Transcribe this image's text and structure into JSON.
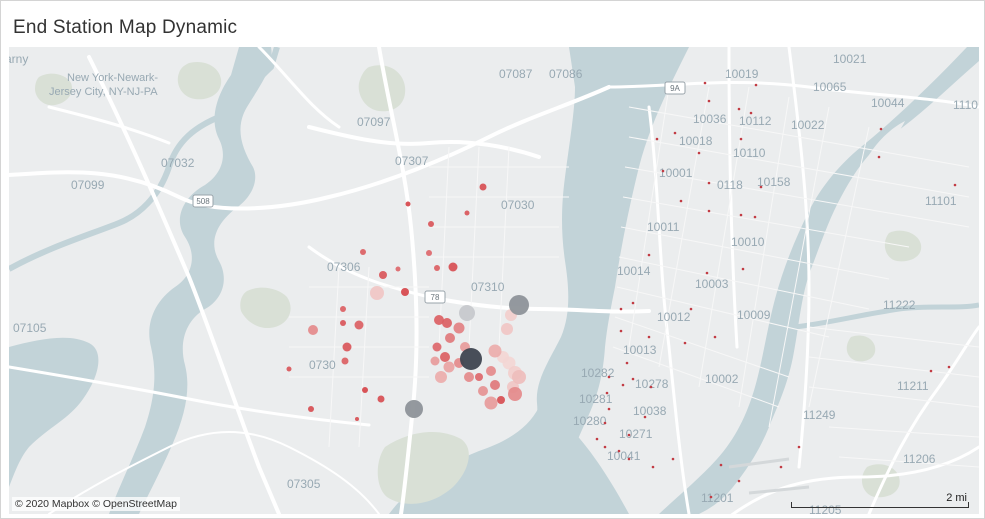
{
  "title": "End Station Map Dynamic",
  "attribution": "© 2020 Mapbox © OpenStreetMap",
  "scale": {
    "label": "2 mi"
  },
  "colors": {
    "water": "#c2d3d8",
    "land": "#ebedee",
    "park": "#d9e0d6",
    "road": "#ffffff",
    "label": "#98a9b3"
  },
  "map_labels": [
    "arny",
    "New York-Newark-",
    "Jersey City, NY-NJ-PA",
    "07087",
    "07086",
    "10019",
    "10021",
    "10065",
    "10044",
    "1110",
    "07097",
    "10036",
    "10112",
    "10022",
    "10018",
    "07032",
    "07307",
    "10110",
    "07099",
    "10001",
    "0118",
    "10158",
    "07030",
    "11101",
    "10011",
    "10010",
    "07306",
    "10014",
    "10003",
    "07310",
    "11222",
    "07105",
    "10012",
    "10009",
    "10013",
    "0730",
    "10282",
    "10278",
    "10002",
    "11211",
    "10281",
    "10038",
    "11249",
    "10280",
    "10271",
    "10041",
    "11206",
    "07305",
    "11201",
    "11205"
  ],
  "road_shields": [
    "508",
    "9A",
    "78"
  ],
  "stations": [
    {
      "name": "s1",
      "level": 0.85
    },
    {
      "name": "s2",
      "level": 0.9
    },
    {
      "name": "s3",
      "level": 0.8
    },
    {
      "name": "s4",
      "level": 0.8
    },
    {
      "name": "s5",
      "level": 0.75
    },
    {
      "name": "s6",
      "level": 0.7
    },
    {
      "name": "s7",
      "level": 0.75
    },
    {
      "name": "s8",
      "level": 0.85
    },
    {
      "name": "s9",
      "level": 0.8
    },
    {
      "name": "s10",
      "level": 0.7
    },
    {
      "name": "s11",
      "level": 0.15
    },
    {
      "name": "s12",
      "level": 0.9
    },
    {
      "name": "s13",
      "level": 0.75
    },
    {
      "name": "s14",
      "level": 0.75
    },
    {
      "name": "s15",
      "level": 0.5
    },
    {
      "name": "s16",
      "level": 0.8
    },
    {
      "name": "s17",
      "level": 0.8
    },
    {
      "name": "s18",
      "level": 0.75
    },
    {
      "name": "s19",
      "level": 0.8
    },
    {
      "name": "s20",
      "level": 0.85
    },
    {
      "name": "s21",
      "level": 0.85
    },
    {
      "name": "s22",
      "level": 0.9
    },
    {
      "name": "s23",
      "level": 0.85
    },
    {
      "name": "s24",
      "level": 0.75
    },
    {
      "name": "s25",
      "level": 0.75
    },
    {
      "name": "s26",
      "level": 0.55
    },
    {
      "name": "s27",
      "level": 0.6
    },
    {
      "name": "s28",
      "level": 0.4
    },
    {
      "name": "s29",
      "level": 0.5
    },
    {
      "name": "s30",
      "level": 0.7
    },
    {
      "name": "s31",
      "level": 0.75
    },
    {
      "name": "s32",
      "level": 0.4
    },
    {
      "name": "s33",
      "level": 0.35
    },
    {
      "name": "s34",
      "level": 0.3
    },
    {
      "name": "s35",
      "level": 0.5
    },
    {
      "name": "s36",
      "level": 0.7
    },
    {
      "name": "s37",
      "level": 0.5
    },
    {
      "name": "s38",
      "level": 0.45
    },
    {
      "name": "s39",
      "level": 0.6
    },
    {
      "name": "s40",
      "level": 0.85
    },
    {
      "name": "s41",
      "level": 0.4
    },
    {
      "name": "s42",
      "level": 0.05
    },
    {
      "name": "s43",
      "level": 0.05
    },
    {
      "name": "s44",
      "level": 0.1
    },
    {
      "name": "s45",
      "level": 0.15
    },
    {
      "name": "s46",
      "level": 0.2
    },
    {
      "name": "s47",
      "level": 0.3
    },
    {
      "name": "s48",
      "level": 0.5
    },
    {
      "name": "s49",
      "level": 0.15
    },
    {
      "name": "s50",
      "level": 0.1
    }
  ],
  "grey_stations": [
    {
      "name": "g1",
      "tone": "dark"
    },
    {
      "name": "g2",
      "tone": "mid"
    },
    {
      "name": "g3",
      "tone": "light"
    },
    {
      "name": "g4",
      "tone": "mid"
    }
  ],
  "ny_markers_count": 52
}
